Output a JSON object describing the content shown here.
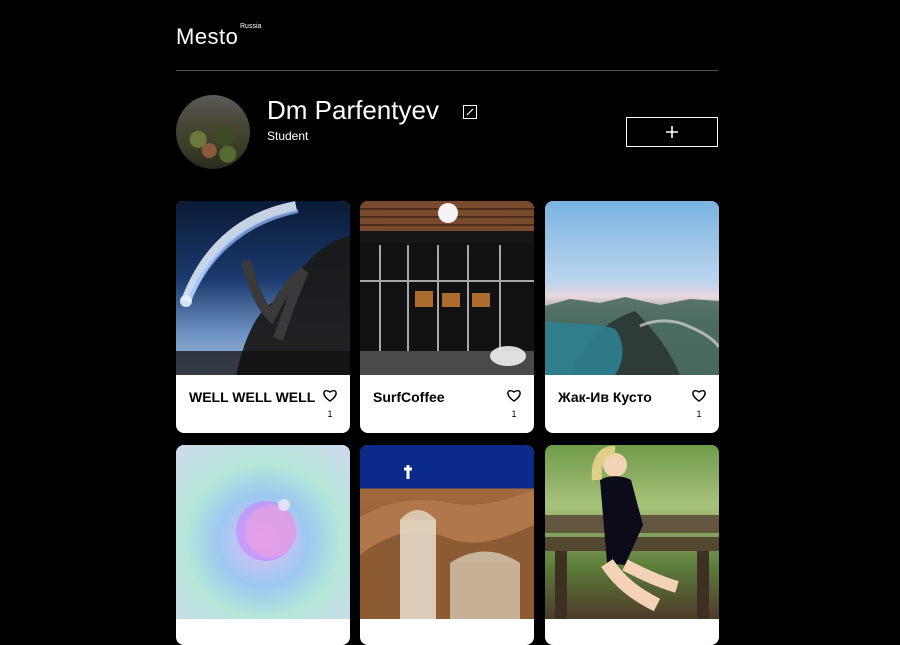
{
  "header": {
    "logo": "Mesto",
    "logo_sup": "Russia"
  },
  "profile": {
    "name": "Dm Parfentyev",
    "about": "Student"
  },
  "cards": [
    {
      "title": "WELL WELL WELL",
      "likes": "1",
      "image": "dinosaur-comet"
    },
    {
      "title": "SurfCoffee",
      "likes": "1",
      "image": "cafe-storefront"
    },
    {
      "title": "Жак-Ив Кусто",
      "likes": "1",
      "image": "coastal-cliffs"
    },
    {
      "title": "",
      "likes": "",
      "image": "gradient-sphere"
    },
    {
      "title": "",
      "likes": "",
      "image": "church-statue-rocks"
    },
    {
      "title": "",
      "likes": "",
      "image": "woman-on-bench"
    }
  ],
  "icons": {
    "edit": "edit-icon",
    "add": "plus-icon",
    "like": "heart-icon"
  },
  "colors": {
    "background": "#000000",
    "card": "#ffffff",
    "divider": "#545454"
  }
}
